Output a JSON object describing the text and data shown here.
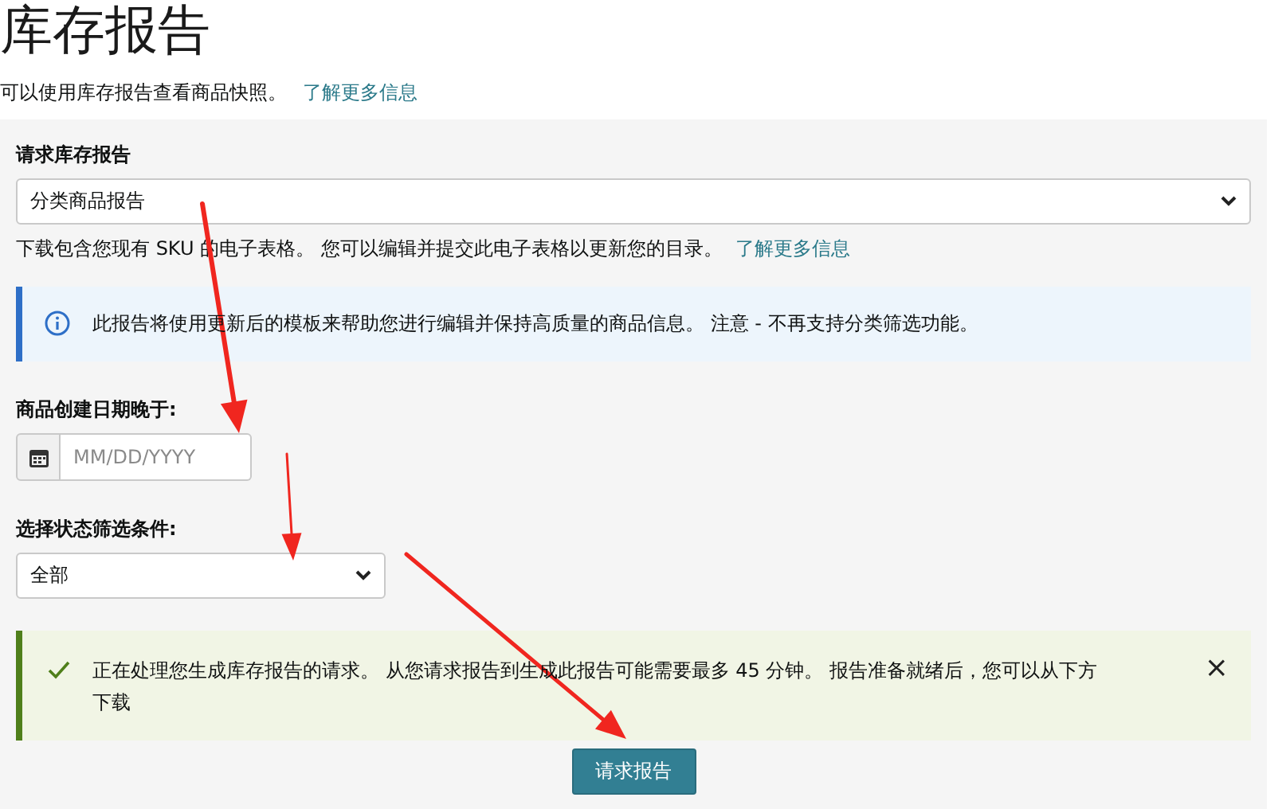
{
  "page": {
    "title": "库存报告",
    "intro": "可以使用库存报告查看商品快照。",
    "intro_link": "了解更多信息"
  },
  "report_select": {
    "label": "请求库存报告",
    "value": "分类商品报告",
    "help": "下载包含您现有 SKU 的电子表格。 您可以编辑并提交此电子表格以更新您的目录。",
    "help_link": "了解更多信息"
  },
  "info_alert": {
    "kind": "info",
    "text": "此报告将使用更新后的模板来帮助您进行编辑并保持高质量的商品信息。 注意 - 不再支持分类筛选功能。"
  },
  "date_field": {
    "label": "商品创建日期晚于:",
    "placeholder": "MM/DD/YYYY"
  },
  "status_select": {
    "label": "选择状态筛选条件:",
    "value": "全部"
  },
  "success_alert": {
    "kind": "success",
    "text": "正在处理您生成库存报告的请求。 从您请求报告到生成此报告可能需要最多 45 分钟。 报告准备就绪后，您可以从下方下载",
    "close_button": "×"
  },
  "submit_button": "请求报告",
  "annotations": [
    {
      "kind": "arrow"
    },
    {
      "kind": "arrow"
    },
    {
      "kind": "arrow"
    }
  ]
}
